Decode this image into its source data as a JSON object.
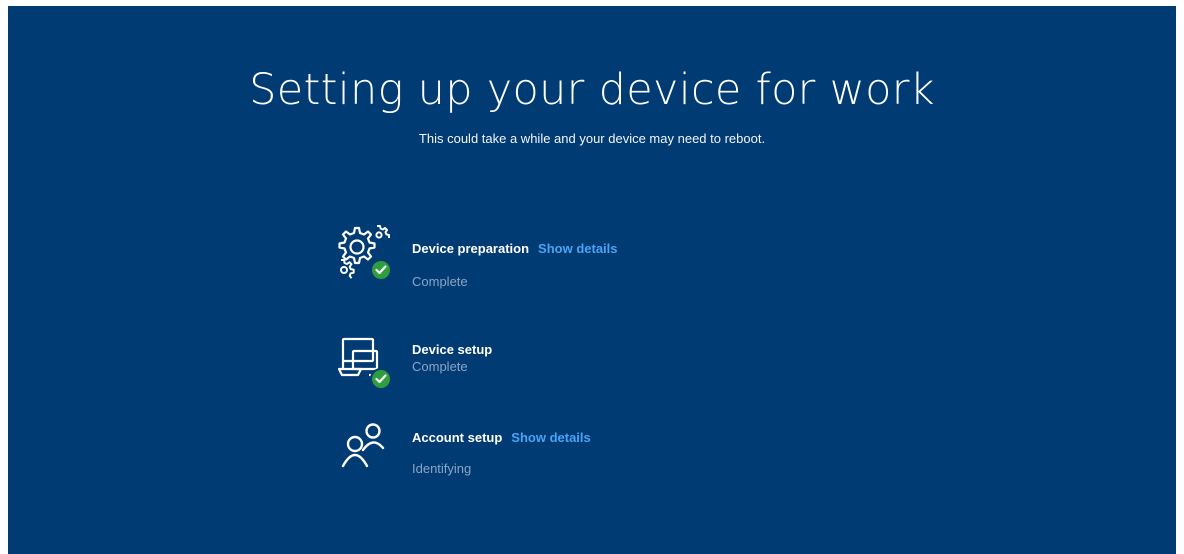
{
  "header": {
    "title": "Setting up your device for work",
    "subtitle": "This could take a while and your device may need to reboot."
  },
  "steps": [
    {
      "icon": "gears-icon",
      "title": "Device preparation",
      "details_link": "Show details",
      "status": "Complete",
      "complete": true
    },
    {
      "icon": "devices-icon",
      "title": "Device setup",
      "status": "Complete",
      "complete": true
    },
    {
      "icon": "account-icon",
      "title": "Account setup",
      "details_link": "Show details",
      "status": "Identifying",
      "complete": false
    }
  ],
  "colors": {
    "background": "#003b73",
    "link": "#4aa3f5",
    "status_text": "#8aa5c6",
    "check_badge": "#2e9e3e"
  }
}
